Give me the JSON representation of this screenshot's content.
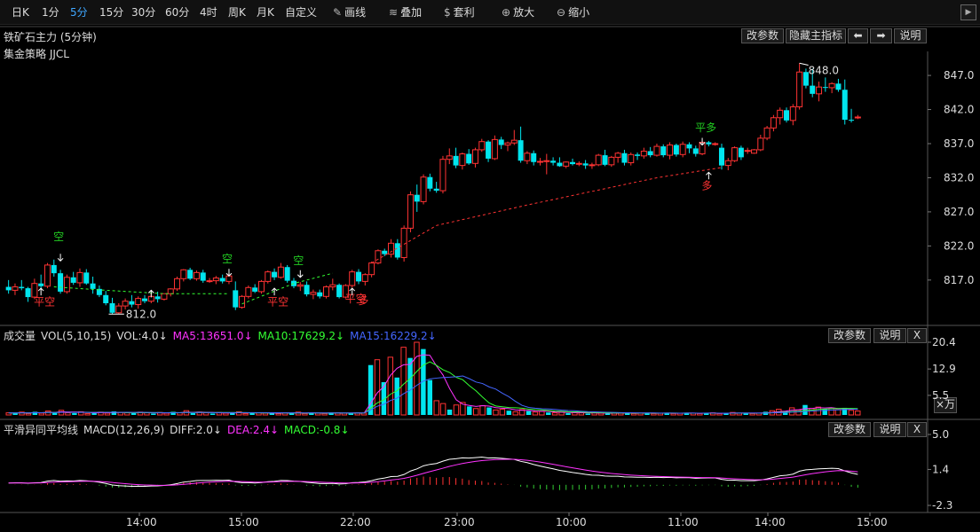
{
  "toolbar": {
    "periods": [
      "日K",
      "1分",
      "5分",
      "15分",
      "30分",
      "60分",
      "4时",
      "周K",
      "月K",
      "自定义"
    ],
    "active_period": "5分",
    "tools": [
      {
        "label": "画线",
        "icon": "pencil-icon"
      },
      {
        "label": "叠加",
        "icon": "layers-icon"
      },
      {
        "label": "套利",
        "icon": "money-bag-icon"
      },
      {
        "label": "放大",
        "icon": "zoom-in-icon"
      },
      {
        "label": "缩小",
        "icon": "zoom-out-icon"
      }
    ],
    "collapse": "▶"
  },
  "main_panel": {
    "title": "铁矿石主力 (5分钟)",
    "strategy": "集金策略 JJCL",
    "buttons": [
      "改参数",
      "隐藏主指标",
      "⬅",
      "➡",
      "说明"
    ],
    "annotations": {
      "high_label": "848.0",
      "low_label": "812.0",
      "signals": [
        {
          "text": "空",
          "color": "#22cc22"
        },
        {
          "text": "平空",
          "color": "#ff3333"
        },
        {
          "text": "空",
          "color": "#22cc22"
        },
        {
          "text": "平空",
          "color": "#ff3333"
        },
        {
          "text": "空",
          "color": "#22cc22"
        },
        {
          "text": "平空",
          "color": "#ff3333"
        },
        {
          "text": "多",
          "color": "#ff3333"
        },
        {
          "text": "平多",
          "color": "#22cc22"
        },
        {
          "text": "多",
          "color": "#ff3333"
        }
      ]
    }
  },
  "volume_panel": {
    "title": "成交量",
    "legend": [
      {
        "text": "VOL(5,10,15)",
        "color": "#dddddd"
      },
      {
        "text": "VOL:4.0↓",
        "color": "#dddddd"
      },
      {
        "text": "MA5:13651.0↓",
        "color": "#ff33ff"
      },
      {
        "text": "MA10:17629.2↓",
        "color": "#33ff33"
      },
      {
        "text": "MA15:16229.2↓",
        "color": "#4466ff"
      }
    ],
    "buttons": [
      "改参数",
      "说明",
      "X"
    ],
    "unit_label": "×万"
  },
  "macd_panel": {
    "title": "平滑异同平均线",
    "legend": [
      {
        "text": "MACD(12,26,9)",
        "color": "#dddddd"
      },
      {
        "text": "DIFF:2.0↓",
        "color": "#dddddd"
      },
      {
        "text": "DEA:2.4↓",
        "color": "#ff33ff"
      },
      {
        "text": "MACD:-0.8↓",
        "color": "#33ff33"
      }
    ],
    "buttons": [
      "改参数",
      "说明",
      "X"
    ]
  },
  "colors": {
    "up": "#ff3333",
    "down": "#00e5ee",
    "diff": "#ffffff",
    "dea": "#ff33ff",
    "bg": "#000000"
  },
  "chart_data": [
    {
      "type": "candlestick",
      "title": "铁矿石主力 (5分钟)",
      "ylim": [
        811,
        850
      ],
      "y_ticks": [
        "847.0",
        "842.0",
        "837.0",
        "832.0",
        "827.0",
        "822.0",
        "817.0"
      ],
      "x_ticks": [
        "14:00",
        "15:00",
        "22:00",
        "23:00",
        "10:00",
        "11:00",
        "14:00",
        "15:00"
      ],
      "candles": [
        [
          816,
          817,
          815,
          815.5
        ],
        [
          815.5,
          816.5,
          814.8,
          816
        ],
        [
          816,
          817,
          815.5,
          815.8
        ],
        [
          815.8,
          816,
          813.8,
          814.5
        ],
        [
          814.5,
          817.2,
          814.2,
          816.5
        ],
        [
          816.5,
          817.8,
          815.6,
          816.1
        ],
        [
          816.1,
          819.5,
          815.8,
          819.2
        ],
        [
          819.2,
          820,
          817.5,
          818
        ],
        [
          818,
          818.5,
          815,
          815.3
        ],
        [
          815.3,
          817.8,
          815,
          817.4
        ],
        [
          817.4,
          818.2,
          816.3,
          816.6
        ],
        [
          816.6,
          818.7,
          816,
          818.1
        ],
        [
          818.1,
          818.6,
          816.3,
          816.5
        ],
        [
          816.5,
          817.5,
          815,
          815.7
        ],
        [
          815.7,
          816.2,
          814.5,
          814.8
        ],
        [
          814.8,
          815.4,
          813.3,
          813.6
        ],
        [
          813.6,
          814.4,
          812,
          812.2
        ],
        [
          812.2,
          813.6,
          812,
          813.2
        ],
        [
          813.2,
          814.3,
          812.7,
          813.9
        ],
        [
          813.9,
          814.8,
          813,
          813.4
        ],
        [
          813.4,
          814.6,
          812.8,
          814.3
        ],
        [
          814.3,
          814.8,
          813.6,
          813.9
        ],
        [
          813.9,
          815.2,
          813.6,
          814.6
        ],
        [
          814.6,
          815.3,
          813.7,
          814.2
        ],
        [
          814.2,
          815,
          814,
          815
        ],
        [
          815,
          815.8,
          814.6,
          815.7
        ],
        [
          815.7,
          817.5,
          815.4,
          817.2
        ],
        [
          817.2,
          818.6,
          816.8,
          818.5
        ],
        [
          818.5,
          818.8,
          817,
          817.2
        ],
        [
          817.2,
          818.4,
          816.9,
          818.1
        ],
        [
          818.1,
          818.5,
          816.6,
          816.9
        ],
        [
          816.9,
          817.3,
          816.6,
          816.9
        ],
        [
          816.9,
          817.6,
          816.4,
          817.3
        ],
        [
          817.3,
          817.8,
          816.5,
          816.8
        ],
        [
          816.8,
          818,
          816.4,
          817.6
        ],
        [
          815.5,
          816.8,
          812.6,
          813
        ],
        [
          813,
          814.8,
          812.8,
          814.6
        ],
        [
          814.6,
          816.2,
          814.3,
          815.9
        ],
        [
          815.9,
          816.4,
          815.1,
          815.3
        ],
        [
          815.3,
          817,
          815,
          816.8
        ],
        [
          816.8,
          818.4,
          816.5,
          818.2
        ],
        [
          818.2,
          818.7,
          817,
          817.4
        ],
        [
          817.4,
          819.5,
          817.2,
          818.9
        ],
        [
          818.9,
          819.2,
          816.6,
          816.9
        ],
        [
          816.9,
          817.3,
          815.8,
          816.1
        ],
        [
          816.1,
          816.7,
          815.4,
          816.3
        ],
        [
          816.3,
          816.8,
          814.6,
          814.9
        ],
        [
          814.9,
          815.6,
          814.2,
          815.2
        ],
        [
          815.2,
          815.6,
          814.3,
          814.6
        ],
        [
          814.6,
          816.2,
          814.3,
          816
        ],
        [
          816,
          817.2,
          815.5,
          816.3
        ],
        [
          816.3,
          816.5,
          814.3,
          814.5
        ],
        [
          814.5,
          816.4,
          814.3,
          816.2
        ],
        [
          816.2,
          818.5,
          815.9,
          818.2
        ],
        [
          818.2,
          818.6,
          816.4,
          816.8
        ],
        [
          816.8,
          818,
          816.2,
          817.8
        ],
        [
          817.8,
          819.7,
          817.4,
          819.5
        ],
        [
          819.5,
          821.5,
          819.3,
          821.3
        ],
        [
          821.3,
          821.6,
          820.5,
          820.8
        ],
        [
          820.8,
          823,
          820.3,
          822.4
        ],
        [
          822.4,
          823,
          820,
          820.3
        ],
        [
          820.3,
          825,
          819.7,
          824.6
        ],
        [
          824.6,
          830,
          824,
          829.5
        ],
        [
          829.5,
          831,
          827,
          828.5
        ],
        [
          828.5,
          832.5,
          828.1,
          832.1
        ],
        [
          832.1,
          832.6,
          830,
          830.4
        ],
        [
          830.4,
          831.4,
          829.8,
          830.1
        ],
        [
          830.1,
          835.2,
          829.7,
          834.7
        ],
        [
          834.7,
          836.3,
          834,
          835.2
        ],
        [
          835.2,
          836.4,
          833.4,
          833.8
        ],
        [
          833.8,
          835.7,
          833.2,
          835.5
        ],
        [
          835.5,
          836.2,
          833.9,
          834.1
        ],
        [
          834.1,
          836.4,
          833.5,
          836.1
        ],
        [
          836.1,
          837.7,
          835.8,
          837.3
        ],
        [
          837.3,
          837.5,
          834.3,
          834.8
        ],
        [
          834.8,
          838.2,
          834.6,
          837.6
        ],
        [
          837.6,
          838,
          836.2,
          836.8
        ],
        [
          836.8,
          837.3,
          835.9,
          837.1
        ],
        [
          837.1,
          839,
          836.8,
          837.5
        ],
        [
          837.5,
          839.5,
          834.2,
          834.5
        ],
        [
          834.5,
          835.9,
          834,
          835.6
        ],
        [
          835.6,
          836,
          833.8,
          834.3
        ],
        [
          834.3,
          834.9,
          833.8,
          834.4
        ],
        [
          834.4,
          835.5,
          832.5,
          834.5
        ],
        [
          834.5,
          835,
          833.8,
          834.2
        ],
        [
          834.2,
          835,
          833.6,
          833.7
        ],
        [
          833.7,
          834.4,
          833.4,
          834.3
        ],
        [
          834.3,
          834.8,
          833.8,
          834
        ],
        [
          834,
          834.4,
          833.7,
          834.1
        ],
        [
          834.1,
          834.6,
          833.3,
          833.8
        ],
        [
          833.8,
          834.2,
          833.3,
          833.9
        ],
        [
          833.9,
          835.5,
          833.7,
          835.3
        ],
        [
          835.3,
          836.1,
          833.7,
          833.9
        ],
        [
          833.9,
          835.2,
          833.6,
          835
        ],
        [
          835,
          835.8,
          834.2,
          835.6
        ],
        [
          835.6,
          836.1,
          833.8,
          834.2
        ],
        [
          834.2,
          835.7,
          833.8,
          835.4
        ],
        [
          835.4,
          835.7,
          834.6,
          835.2
        ],
        [
          835.2,
          836.4,
          834.8,
          835.9
        ],
        [
          835.9,
          836.5,
          835,
          835.3
        ],
        [
          835.3,
          837,
          835.1,
          836.6
        ],
        [
          836.6,
          836.9,
          835,
          835.3
        ],
        [
          835.3,
          837.2,
          834.7,
          836.8
        ],
        [
          836.8,
          837,
          835.1,
          835.4
        ],
        [
          835.4,
          837.3,
          835,
          836.9
        ],
        [
          836.9,
          837.2,
          835.6,
          836.3
        ],
        [
          836.3,
          836.7,
          835.1,
          835.5
        ],
        [
          835.5,
          837.4,
          835.3,
          837.2
        ],
        [
          837.2,
          837.4,
          836.6,
          836.9
        ],
        [
          836.9,
          837.2,
          836.7,
          837
        ],
        [
          836.4,
          837,
          833.2,
          833.8
        ],
        [
          833.8,
          834.9,
          833.1,
          834.5
        ],
        [
          834.5,
          836.6,
          834.3,
          836.4
        ],
        [
          836.4,
          836.7,
          834.6,
          835
        ],
        [
          836,
          836.4,
          835.5,
          836
        ],
        [
          835.6,
          836.2,
          835.5,
          836.1
        ],
        [
          836.1,
          838.3,
          835.9,
          837.8
        ],
        [
          837.8,
          839.6,
          837.5,
          839.3
        ],
        [
          839.3,
          841.2,
          838.8,
          840.8
        ],
        [
          840.8,
          842.3,
          839.8,
          841.9
        ],
        [
          841.9,
          842.3,
          840.1,
          840.4
        ],
        [
          840.4,
          842.8,
          839.7,
          842.4
        ],
        [
          842.4,
          848.8,
          842,
          847.5
        ],
        [
          847.5,
          848,
          845.1,
          845.5
        ],
        [
          845.5,
          848,
          843.8,
          844.3
        ],
        [
          844.3,
          846.1,
          843.2,
          845.3
        ],
        [
          845.3,
          846.7,
          844.6,
          845.2
        ],
        [
          845.2,
          846,
          844.4,
          845.8
        ],
        [
          845.8,
          846.5,
          844.6,
          844.9
        ],
        [
          844.9,
          846.4,
          839.8,
          840.5
        ],
        [
          840.5,
          842.1,
          840.1,
          840.4
        ],
        [
          840.8,
          841.2,
          840.6,
          840.9
        ]
      ]
    },
    {
      "type": "bar",
      "title": "成交量 VOL(5,10,15)",
      "y_ticks": [
        "20.4",
        "12.9",
        "5.5"
      ],
      "ylim": [
        0,
        20.4
      ],
      "series_note": "volume in 万",
      "values": [
        0.6,
        0.5,
        0.8,
        0.4,
        0.9,
        0.5,
        1.1,
        0.7,
        1.3,
        0.6,
        0.5,
        0.9,
        0.4,
        0.6,
        0.8,
        0.5,
        1.0,
        0.7,
        0.6,
        0.5,
        0.8,
        0.6,
        0.4,
        0.7,
        0.5,
        0.9,
        0.6,
        1.2,
        0.5,
        0.8,
        0.6,
        0.4,
        0.7,
        0.5,
        0.6,
        0.9,
        0.4,
        0.5,
        0.6,
        0.5,
        0.7,
        0.4,
        0.6,
        0.5,
        0.8,
        0.4,
        0.6,
        0.5,
        0.4,
        0.7,
        0.6,
        0.5,
        0.4,
        0.6,
        0.5,
        14.0,
        15.5,
        9.2,
        16.2,
        10.5,
        19.0,
        16.0,
        20.4,
        18.5,
        9.8,
        4.0,
        3.2,
        1.5,
        2.8,
        3.5,
        2.4,
        1.8,
        2.6,
        2.1,
        1.4,
        1.6,
        1.2,
        0.9,
        1.5,
        1.1,
        0.8,
        1.0,
        0.7,
        0.6,
        0.8,
        0.5,
        0.7,
        0.6,
        0.4,
        0.6,
        0.5,
        0.4,
        0.6,
        0.5,
        0.7,
        0.4,
        0.5,
        0.6,
        0.4,
        0.5,
        0.6,
        0.4,
        0.5,
        0.6,
        0.5,
        0.4,
        0.5,
        0.6,
        0.4,
        0.5,
        0.7,
        0.5,
        0.6,
        0.4,
        0.5,
        0.9,
        1.2,
        1.6,
        1.1,
        2.0,
        1.4,
        2.8,
        1.8,
        2.2,
        1.6,
        1.9,
        1.5,
        2.0,
        1.3,
        1.1
      ],
      "series": [
        {
          "name": "MA5",
          "color": "#ff33ff"
        },
        {
          "name": "MA10",
          "color": "#33ff33"
        },
        {
          "name": "MA15",
          "color": "#4466ff"
        }
      ]
    },
    {
      "type": "line",
      "title": "MACD(12,26,9)",
      "y_ticks": [
        "5.0",
        "1.4",
        "-2.3"
      ],
      "ylim": [
        -2.3,
        5.0
      ],
      "series": [
        {
          "name": "DIFF",
          "color": "#ffffff"
        },
        {
          "name": "DEA",
          "color": "#ff33ff"
        },
        {
          "name": "MACD",
          "color": "#ff3333"
        }
      ]
    }
  ]
}
